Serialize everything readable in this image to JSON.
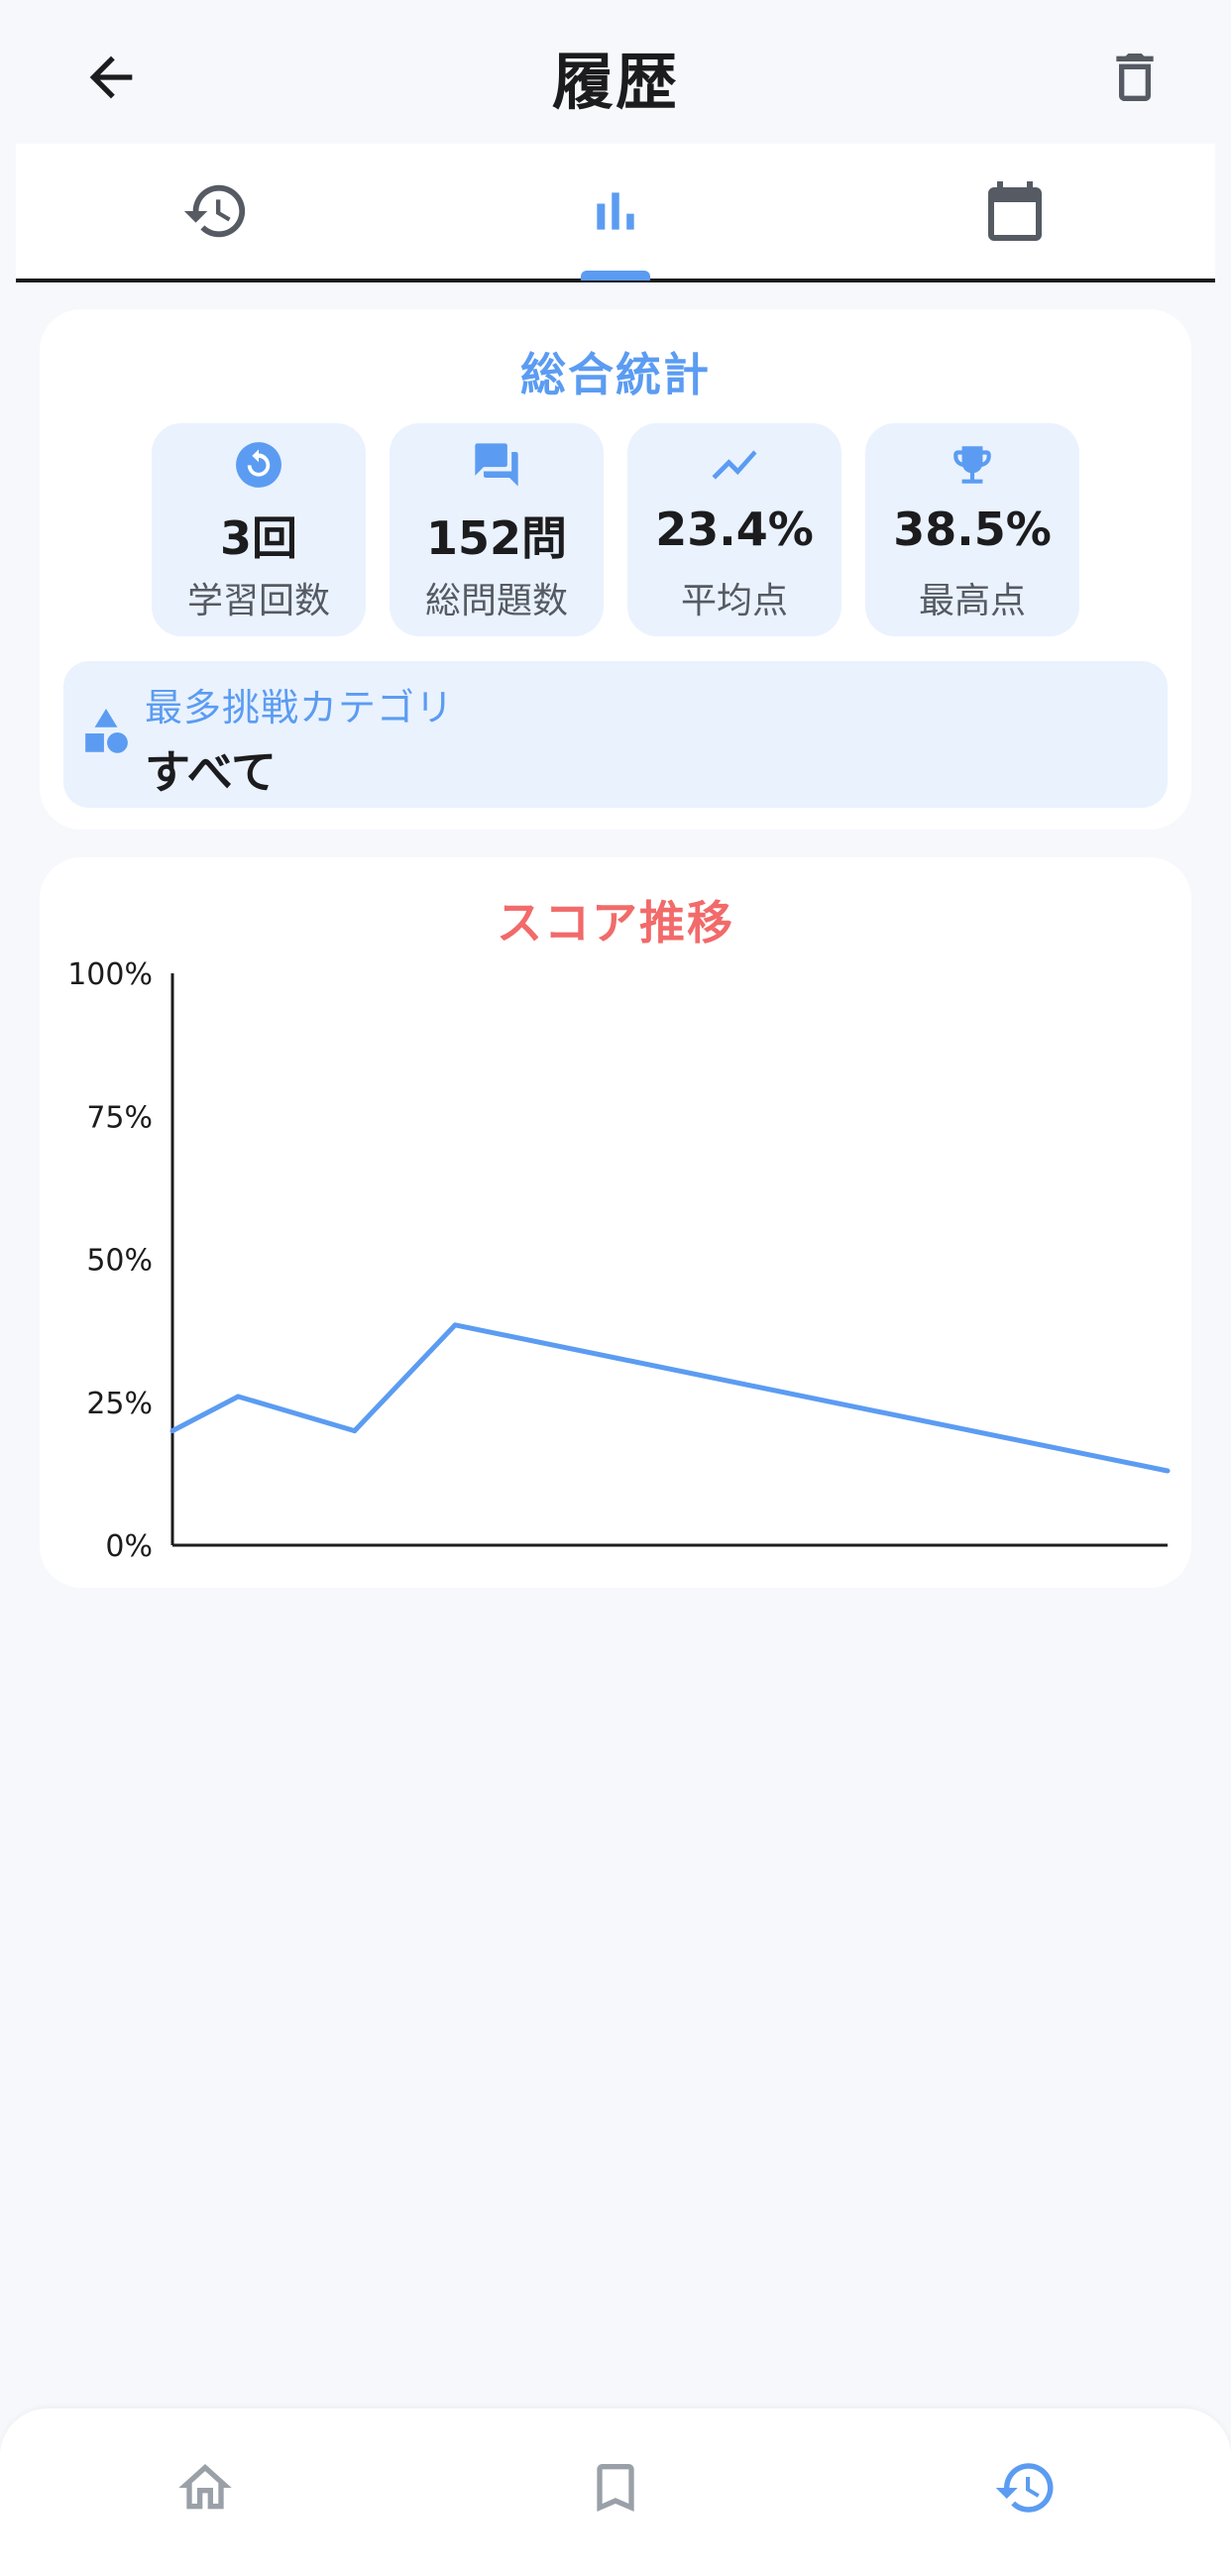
{
  "appbar": {
    "title": "履歴"
  },
  "tabs": [
    {
      "icon": "history-icon"
    },
    {
      "icon": "bar-chart-icon",
      "selected": true
    },
    {
      "icon": "calendar-icon"
    }
  ],
  "stats": {
    "title": "総合統計",
    "tiles": [
      {
        "icon": "replay-icon",
        "value": "3回",
        "label": "学習回数"
      },
      {
        "icon": "chat-icon",
        "value": "152問",
        "label": "総問題数"
      },
      {
        "icon": "trending-icon",
        "value": "23.4%",
        "label": "平均点"
      },
      {
        "icon": "trophy-icon",
        "value": "38.5%",
        "label": "最高点"
      }
    ],
    "category": {
      "icon": "category-icon",
      "label": "最多挑戦カテゴリ",
      "value": "すべて"
    }
  },
  "chart": {
    "title": "スコア推移"
  },
  "chart_data": {
    "type": "line",
    "title": "スコア推移",
    "ylim": [
      0,
      100
    ],
    "yticks": [
      "100%",
      "75%",
      "50%",
      "25%",
      "0%"
    ],
    "ytick_values": [
      100,
      75,
      50,
      25,
      0
    ],
    "x": [
      1,
      2,
      3,
      4,
      5
    ],
    "series": [
      {
        "values": [
          20,
          26,
          20,
          38.5,
          13
        ]
      }
    ],
    "grid": false,
    "line_color": "#5b9cf2"
  },
  "colors": {
    "accent": "#5b9cf2",
    "chart_title": "#f26a6a",
    "tile_bg": "#eaf2fe"
  },
  "bottom_nav": [
    {
      "icon": "home-icon"
    },
    {
      "icon": "bookmark-icon"
    },
    {
      "icon": "history-icon",
      "active": true
    }
  ]
}
